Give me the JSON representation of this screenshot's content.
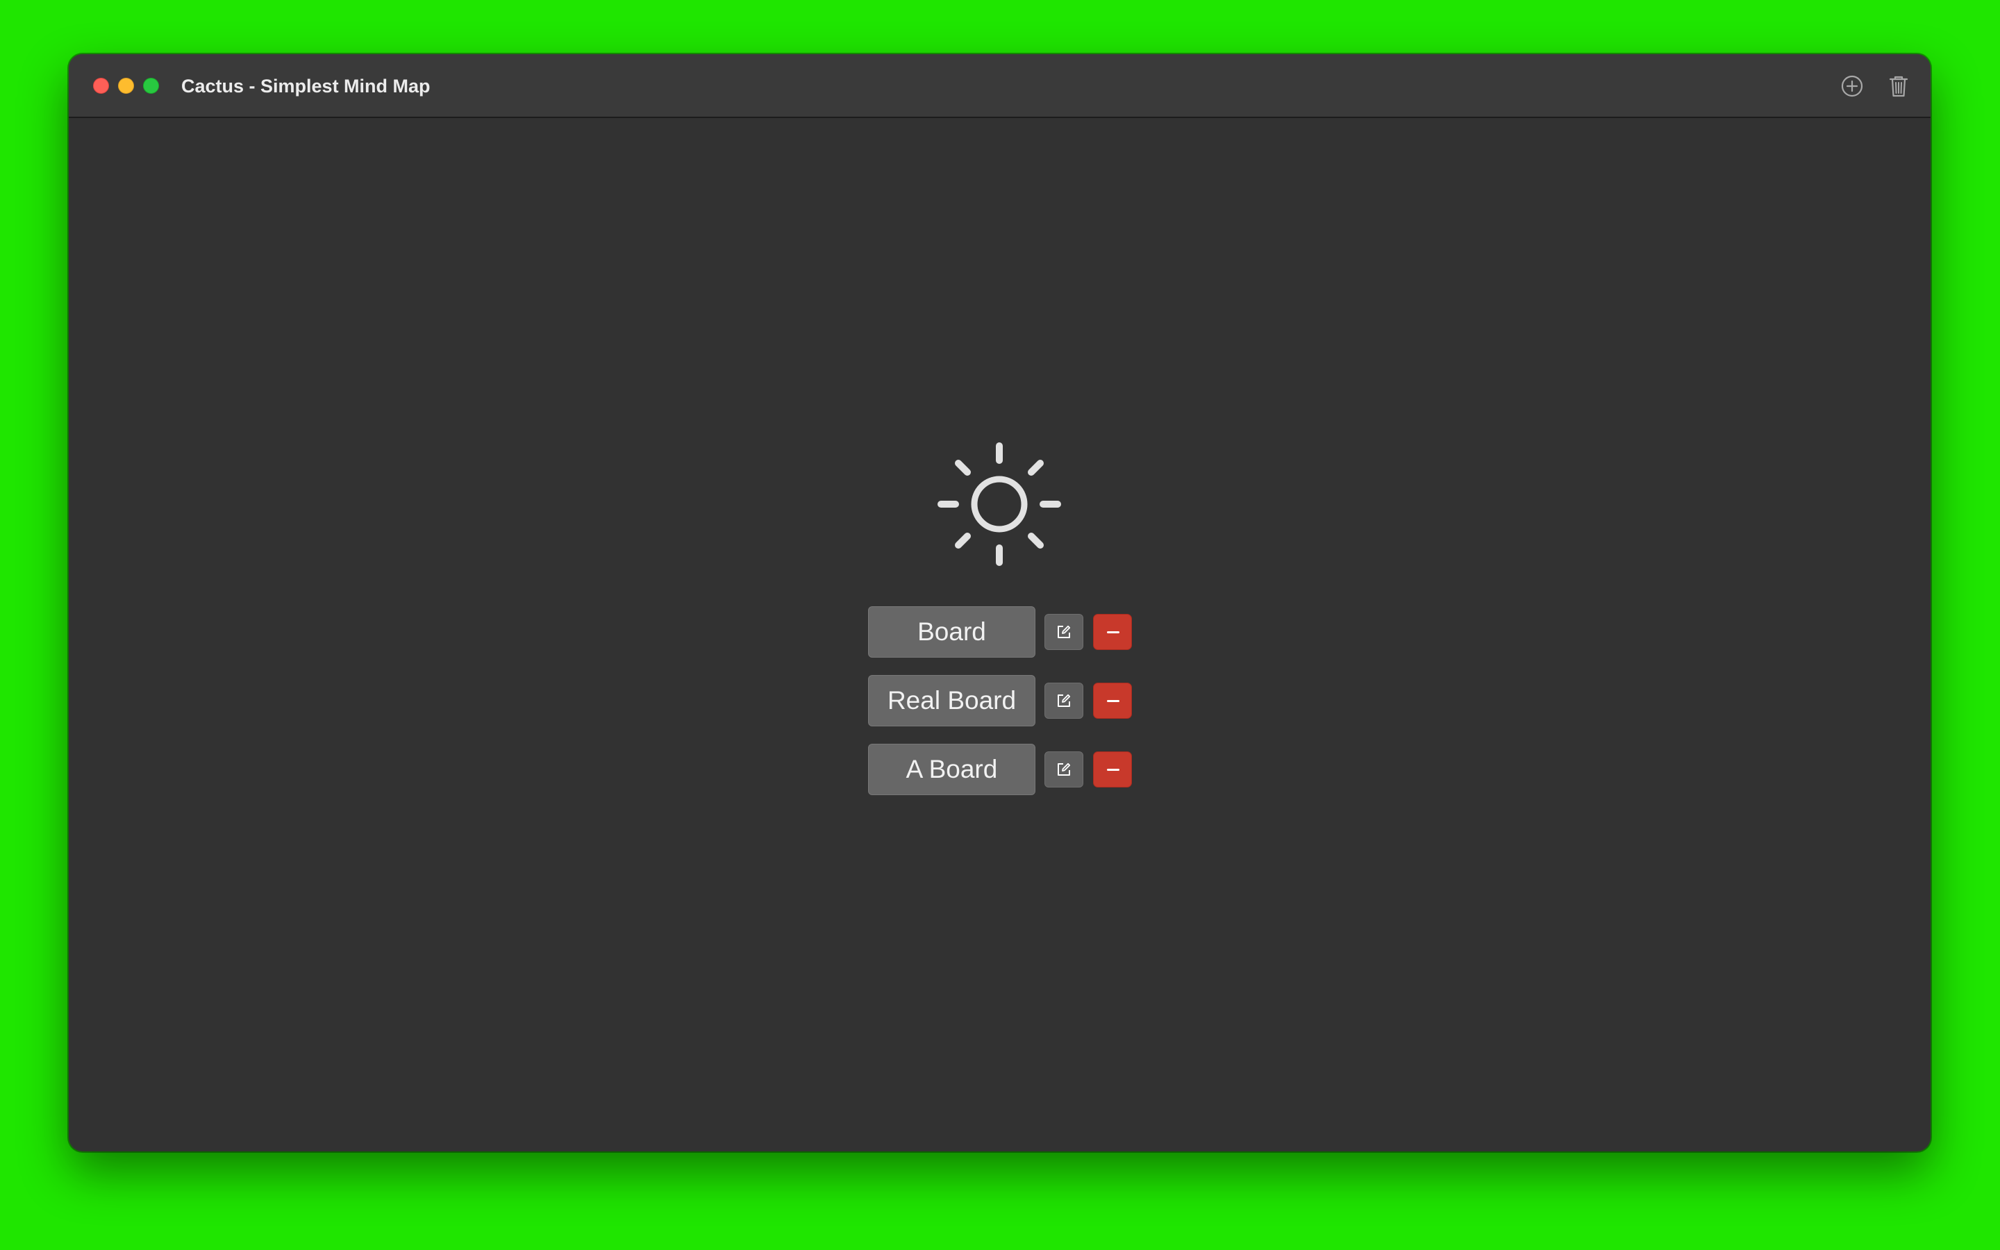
{
  "window": {
    "title": "Cactus - Simplest Mind Map"
  },
  "toolbar": {
    "add_icon": "plus-circle-icon",
    "trash_icon": "trash-icon"
  },
  "theme": {
    "icon": "sun-icon"
  },
  "boards": [
    {
      "label": "Board",
      "edit_icon": "edit-icon",
      "delete_icon": "minus-icon"
    },
    {
      "label": "Real Board",
      "edit_icon": "edit-icon",
      "delete_icon": "minus-icon"
    },
    {
      "label": "A Board",
      "edit_icon": "edit-icon",
      "delete_icon": "minus-icon"
    }
  ],
  "colors": {
    "background": "#1fe600",
    "window": "#323232",
    "titlebar": "#3a3a3a",
    "board_button": "#676767",
    "delete_button": "#c8392b"
  }
}
